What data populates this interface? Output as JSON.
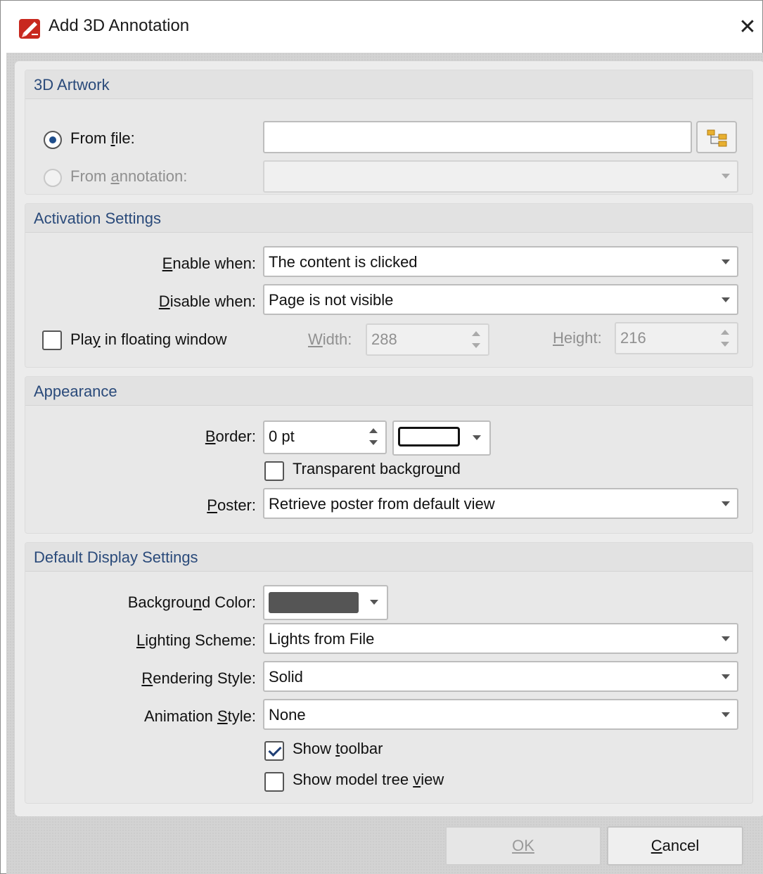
{
  "window": {
    "title": "Add 3D Annotation",
    "close_label": "✕",
    "app_icon": "pdf-editor-app-icon"
  },
  "artwork": {
    "title": "3D Artwork",
    "from_file_label": "From file:",
    "from_file_selected": true,
    "from_file_value": "",
    "browse_icon": "folder-tree-icon",
    "from_annotation_label": "From annotation:",
    "from_annotation_selected": false,
    "from_annotation_value": ""
  },
  "activation": {
    "title": "Activation Settings",
    "enable_when_label": "Enable when:",
    "enable_when_value": "The content is clicked",
    "disable_when_label": "Disable when:",
    "disable_when_value": "Page is not visible",
    "floating_label": "Play in floating window",
    "floating_checked": false,
    "width_label": "Width:",
    "width_value": "288",
    "height_label": "Height:",
    "height_value": "216"
  },
  "appearance": {
    "title": "Appearance",
    "border_label": "Border:",
    "border_value": "0 pt",
    "border_color": "#ffffff",
    "transparent_label": "Transparent background",
    "transparent_checked": false,
    "poster_label": "Poster:",
    "poster_value": "Retrieve poster from default view"
  },
  "display": {
    "title": "Default Display Settings",
    "bg_color_label": "Background Color:",
    "bg_color": "#555555",
    "lighting_label": "Lighting Scheme:",
    "lighting_value": "Lights from File",
    "rendering_label": "Rendering Style:",
    "rendering_value": "Solid",
    "animation_label": "Animation Style:",
    "animation_value": "None",
    "show_toolbar_label": "Show toolbar",
    "show_toolbar_checked": true,
    "show_tree_label": "Show model tree view",
    "show_tree_checked": false
  },
  "footer": {
    "ok_label": "OK",
    "cancel_label": "Cancel"
  }
}
